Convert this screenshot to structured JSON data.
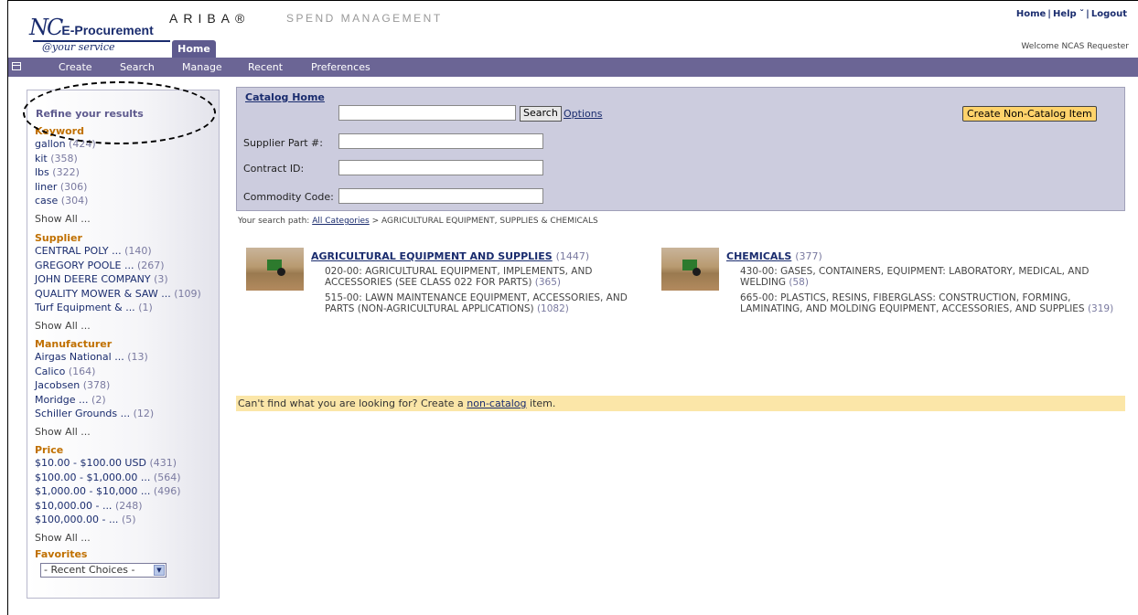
{
  "header": {
    "logo_nc": "NC",
    "logo_ep": "E-Procurement",
    "logo_tagline": "@your service",
    "ariba": "ARIBA®",
    "spend_management": "SPEND MANAGEMENT",
    "home_tab": "Home",
    "links": [
      "Home",
      "Help ˇ",
      "Logout"
    ],
    "welcome": "Welcome NCAS Requester"
  },
  "nav": {
    "items": [
      "Create",
      "Search",
      "Manage",
      "Recent",
      "Preferences"
    ]
  },
  "sidebar": {
    "title": "Refine your results",
    "keyword": {
      "heading": "Keyword",
      "items": [
        {
          "label": "gallon",
          "count": "(424)"
        },
        {
          "label": "kit",
          "count": "(358)"
        },
        {
          "label": "lbs",
          "count": "(322)"
        },
        {
          "label": "liner",
          "count": "(306)"
        },
        {
          "label": "case",
          "count": "(304)"
        }
      ],
      "show_all": "Show All ..."
    },
    "supplier": {
      "heading": "Supplier",
      "items": [
        {
          "label": "CENTRAL POLY ...",
          "count": "(140)"
        },
        {
          "label": "GREGORY POOLE ...",
          "count": "(267)"
        },
        {
          "label": "JOHN DEERE COMPANY",
          "count": "(3)"
        },
        {
          "label": "QUALITY MOWER & SAW ...",
          "count": "(109)"
        },
        {
          "label": "Turf Equipment & ...",
          "count": "(1)"
        }
      ],
      "show_all": "Show All ..."
    },
    "manufacturer": {
      "heading": "Manufacturer",
      "items": [
        {
          "label": "Airgas National ...",
          "count": "(13)"
        },
        {
          "label": "Calico",
          "count": "(164)"
        },
        {
          "label": "Jacobsen",
          "count": "(378)"
        },
        {
          "label": "Moridge ...",
          "count": "(2)"
        },
        {
          "label": "Schiller Grounds ...",
          "count": "(12)"
        }
      ],
      "show_all": "Show All ..."
    },
    "price": {
      "heading": "Price",
      "items": [
        {
          "label": "$10.00 - $100.00 USD",
          "count": "(431)"
        },
        {
          "label": "$100.00 - $1,000.00 ...",
          "count": "(564)"
        },
        {
          "label": "$1,000.00 - $10,000 ...",
          "count": "(496)"
        },
        {
          "label": "$10,000.00 - ...",
          "count": "(248)"
        },
        {
          "label": "$100,000.00 - ...",
          "count": "(5)"
        }
      ],
      "show_all": "Show All ..."
    },
    "favorites": {
      "heading": "Favorites",
      "selected": "- Recent Choices -"
    }
  },
  "search": {
    "catalog_home": "Catalog Home",
    "query_value": "",
    "search_button": "Search",
    "options_link": "Options",
    "create_noncatalog_button": "Create Non-Catalog Item",
    "supplier_part_label": "Supplier Part #:",
    "contract_id_label": "Contract ID:",
    "commodity_code_label": "Commodity Code:"
  },
  "path": {
    "prefix": "Your search path:",
    "root_link": "All Categories",
    "current": "> AGRICULTURAL EQUIPMENT, SUPPLIES & CHEMICALS"
  },
  "categories": [
    {
      "title": "AGRICULTURAL EQUIPMENT AND SUPPLIES",
      "count": "(1447)",
      "subs": [
        {
          "label": "020-00: AGRICULTURAL EQUIPMENT, IMPLEMENTS, AND ACCESSORIES (SEE CLASS 022 FOR PARTS)",
          "count": "(365)"
        },
        {
          "label": "515-00: LAWN MAINTENANCE EQUIPMENT, ACCESSORIES, AND PARTS (NON-AGRICULTURAL APPLICATIONS)",
          "count": "(1082)"
        }
      ]
    },
    {
      "title": "CHEMICALS",
      "count": "(377)",
      "subs": [
        {
          "label": "430-00: GASES, CONTAINERS, EQUIPMENT: LABORATORY, MEDICAL, AND WELDING",
          "count": "(58)"
        },
        {
          "label": "665-00: PLASTICS, RESINS, FIBERGLASS: CONSTRUCTION, FORMING, LAMINATING, AND MOLDING EQUIPMENT, ACCESSORIES, AND SUPPLIES",
          "count": "(319)"
        }
      ]
    }
  ],
  "cant_find": {
    "prefix": "Can't find what you are looking for? Create a",
    "link": "non-catalog",
    "suffix": "item."
  }
}
